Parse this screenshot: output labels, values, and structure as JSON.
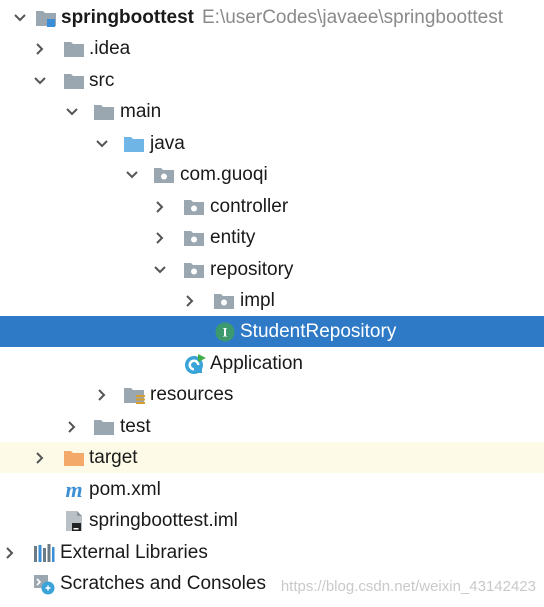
{
  "project": {
    "name": "springboottest",
    "path": "E:\\userCodes\\javaee\\springboottest"
  },
  "tree": {
    "idea": ".idea",
    "src": "src",
    "main": "main",
    "java": "java",
    "package": "com.guoqi",
    "controller": "controller",
    "entity": "entity",
    "repository": "repository",
    "impl": "impl",
    "student_repository": "StudentRepository",
    "interface_badge": "I",
    "application": "Application",
    "resources": "resources",
    "test": "test",
    "target": "target",
    "pom": "pom.xml",
    "pom_badge": "m",
    "iml": "springboottest.iml",
    "external_libraries": "External Libraries",
    "scratches": "Scratches and Consoles"
  },
  "watermark": "https://blog.csdn.net/weixin_43142423",
  "colors": {
    "selection": "#2e7ac7",
    "folder": "#9aa7b0",
    "source_folder": "#6fb6e6",
    "excluded_folder": "#f2a96a",
    "excluded_row": "#fdfbe8",
    "interface_icon": "#3d9a6e"
  },
  "icons": [
    "folder-icon",
    "source-folder-icon",
    "package-icon",
    "interface-icon",
    "spring-class-icon",
    "resources-folder-icon",
    "maven-icon",
    "iml-file-icon",
    "libraries-icon",
    "scratches-icon",
    "chevron-right-icon",
    "chevron-down-icon"
  ]
}
